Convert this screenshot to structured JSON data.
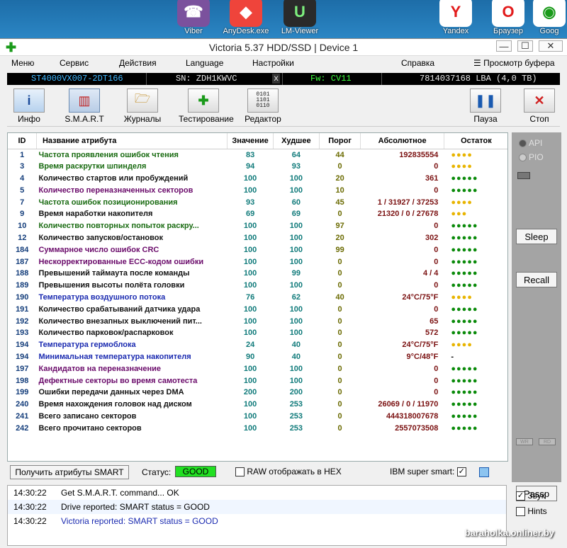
{
  "desktop": {
    "icons": [
      {
        "label": "Viber",
        "color": "#7b519d",
        "glyph": "☎"
      },
      {
        "label": "AnyDesk.exe",
        "color": "#ef443b",
        "glyph": "◆"
      },
      {
        "label": "LM-Viewer",
        "color": "#2a2a2a",
        "glyph": "U"
      },
      {
        "label": "Yandex",
        "color": "#ffffff",
        "glyph": "Y"
      },
      {
        "label": "Браузер",
        "color": "#ffffff",
        "glyph": "O"
      },
      {
        "label": "Goog",
        "color": "#ffffff",
        "glyph": "◉"
      }
    ]
  },
  "window": {
    "title": "Victoria 5.37 HDD/SSD | Device 1",
    "minimize": "—",
    "maximize": "☐",
    "close": "✕"
  },
  "menu": {
    "items": [
      "Меню",
      "Сервис",
      "Действия",
      "Language",
      "Настройки",
      "Справка"
    ],
    "clipboard_view": "Просмотр буфера"
  },
  "device": {
    "model": "ST4000VX007-2DT166",
    "serial": "SN: ZDH1KWVC",
    "x": "x",
    "firmware": "Fw: CV11",
    "lba": "7814037168 LBA (4,0 TB)"
  },
  "toolbar": {
    "info": "Инфо",
    "smart": "S.M.A.R.T",
    "logs": "Журналы",
    "test": "Тестирование",
    "editor": "Редактор",
    "pause": "Пауза",
    "stop": "Стоп"
  },
  "smart_table": {
    "headers": {
      "id": "ID",
      "name": "Название атрибута",
      "value": "Значение",
      "worst": "Худшее",
      "threshold": "Порог",
      "raw": "Абсолютное",
      "remaining": "Остаток"
    },
    "rows": [
      {
        "id": "1",
        "name": "Частота проявления ошибок чтения",
        "value": "83",
        "worst": "64",
        "threshold": "44",
        "raw": "192835554",
        "remaining": "●●●●",
        "nc": "green",
        "dc": "yellow"
      },
      {
        "id": "3",
        "name": "Время раскрутки шпинделя",
        "value": "94",
        "worst": "93",
        "threshold": "0",
        "raw": "0",
        "remaining": "●●●●",
        "nc": "green",
        "dc": "yellow"
      },
      {
        "id": "4",
        "name": "Количество стартов или пробуждений",
        "value": "100",
        "worst": "100",
        "threshold": "20",
        "raw": "361",
        "remaining": "●●●●●",
        "nc": "black",
        "dc": "green"
      },
      {
        "id": "5",
        "name": "Количество переназначенных секторов",
        "value": "100",
        "worst": "100",
        "threshold": "10",
        "raw": "0",
        "remaining": "●●●●●",
        "nc": "purple",
        "dc": "green"
      },
      {
        "id": "7",
        "name": "Частота ошибок позиционирования",
        "value": "93",
        "worst": "60",
        "threshold": "45",
        "raw": "1 / 31927 / 37253",
        "remaining": "●●●●",
        "nc": "green",
        "dc": "yellow"
      },
      {
        "id": "9",
        "name": "Время наработки накопителя",
        "value": "69",
        "worst": "69",
        "threshold": "0",
        "raw": "21320 / 0 / 27678",
        "remaining": "●●●",
        "nc": "black",
        "dc": "yellow"
      },
      {
        "id": "10",
        "name": "Количество повторных попыток раскру...",
        "value": "100",
        "worst": "100",
        "threshold": "97",
        "raw": "0",
        "remaining": "●●●●●",
        "nc": "green",
        "dc": "green"
      },
      {
        "id": "12",
        "name": "Количество запусков/остановок",
        "value": "100",
        "worst": "100",
        "threshold": "20",
        "raw": "302",
        "remaining": "●●●●●",
        "nc": "black",
        "dc": "green"
      },
      {
        "id": "184",
        "name": "Суммарное число ошибок CRC",
        "value": "100",
        "worst": "100",
        "threshold": "99",
        "raw": "0",
        "remaining": "●●●●●",
        "nc": "purple",
        "dc": "green"
      },
      {
        "id": "187",
        "name": "Нескорректированные ECC-кодом ошибки",
        "value": "100",
        "worst": "100",
        "threshold": "0",
        "raw": "0",
        "remaining": "●●●●●",
        "nc": "purple",
        "dc": "green"
      },
      {
        "id": "188",
        "name": "Превышений таймаута после команды",
        "value": "100",
        "worst": "99",
        "threshold": "0",
        "raw": "4 / 4",
        "remaining": "●●●●●",
        "nc": "black",
        "dc": "green"
      },
      {
        "id": "189",
        "name": "Превышения высоты полёта головки",
        "value": "100",
        "worst": "100",
        "threshold": "0",
        "raw": "0",
        "remaining": "●●●●●",
        "nc": "black",
        "dc": "green"
      },
      {
        "id": "190",
        "name": "Температура воздушного потока",
        "value": "76",
        "worst": "62",
        "threshold": "40",
        "raw": "24°C/75°F",
        "remaining": "●●●●",
        "nc": "blue",
        "dc": "yellow"
      },
      {
        "id": "191",
        "name": "Количество срабатываний датчика удара",
        "value": "100",
        "worst": "100",
        "threshold": "0",
        "raw": "0",
        "remaining": "●●●●●",
        "nc": "black",
        "dc": "green"
      },
      {
        "id": "192",
        "name": "Количество внезапных выключений пит...",
        "value": "100",
        "worst": "100",
        "threshold": "0",
        "raw": "65",
        "remaining": "●●●●●",
        "nc": "black",
        "dc": "green"
      },
      {
        "id": "193",
        "name": "Количество парковок/распарковок",
        "value": "100",
        "worst": "100",
        "threshold": "0",
        "raw": "572",
        "remaining": "●●●●●",
        "nc": "black",
        "dc": "green"
      },
      {
        "id": "194",
        "name": "Температура гермоблока",
        "value": "24",
        "worst": "40",
        "threshold": "0",
        "raw": "24°C/75°F",
        "remaining": "●●●●",
        "nc": "blue",
        "dc": "yellow"
      },
      {
        "id": "194",
        "name": "Минимальная температура накопителя",
        "value": "90",
        "worst": "40",
        "threshold": "0",
        "raw": "9°C/48°F",
        "remaining": "-",
        "nc": "blue",
        "dc": "black"
      },
      {
        "id": "197",
        "name": "Кандидатов на переназначение",
        "value": "100",
        "worst": "100",
        "threshold": "0",
        "raw": "0",
        "remaining": "●●●●●",
        "nc": "purple",
        "dc": "green"
      },
      {
        "id": "198",
        "name": "Дефектные секторы во время самотеста",
        "value": "100",
        "worst": "100",
        "threshold": "0",
        "raw": "0",
        "remaining": "●●●●●",
        "nc": "purple",
        "dc": "green"
      },
      {
        "id": "199",
        "name": "Ошибки передачи данных через DMA",
        "value": "200",
        "worst": "200",
        "threshold": "0",
        "raw": "0",
        "remaining": "●●●●●",
        "nc": "black",
        "dc": "green"
      },
      {
        "id": "240",
        "name": "Время нахождения головок над диском",
        "value": "100",
        "worst": "253",
        "threshold": "0",
        "raw": "26069 / 0 / 11970",
        "remaining": "●●●●●",
        "nc": "black",
        "dc": "green"
      },
      {
        "id": "241",
        "name": "Всего записано секторов",
        "value": "100",
        "worst": "253",
        "threshold": "0",
        "raw": "444318007678",
        "remaining": "●●●●●",
        "nc": "black",
        "dc": "green"
      },
      {
        "id": "242",
        "name": "Всего прочитано секторов",
        "value": "100",
        "worst": "253",
        "threshold": "0",
        "raw": "2557073508",
        "remaining": "●●●●●",
        "nc": "black",
        "dc": "green"
      }
    ]
  },
  "right_panel": {
    "api": "API",
    "pio": "PIO",
    "sleep": "Sleep",
    "recall": "Recall",
    "wr": "WR",
    "rd": "RD",
    "passp": "Passp"
  },
  "bottom": {
    "get_smart": "Получить атрибуты SMART",
    "status_label": "Статус:",
    "status_value": "GOOD",
    "raw_hex": "RAW отображать в HEX",
    "ibm_super_smart": "IBM super smart:"
  },
  "log": [
    {
      "time": "14:30:22",
      "msg": "Get S.M.A.R.T. command... OK",
      "color": "#111111"
    },
    {
      "time": "14:30:22",
      "msg": "Drive reported: SMART status = GOOD",
      "color": "#111111"
    },
    {
      "time": "14:30:22",
      "msg": "Victoria reported: SMART status = GOOD",
      "color": "#1a2ab0"
    }
  ],
  "log_side": {
    "sound": "Звук",
    "hints": "Hints"
  },
  "watermark": "baraholka.onliner.by",
  "colors": {
    "green": "#186a10",
    "purple": "#6a0a6a",
    "blue": "#1a2ab0",
    "black": "#111111",
    "status_good": "#22e022"
  }
}
